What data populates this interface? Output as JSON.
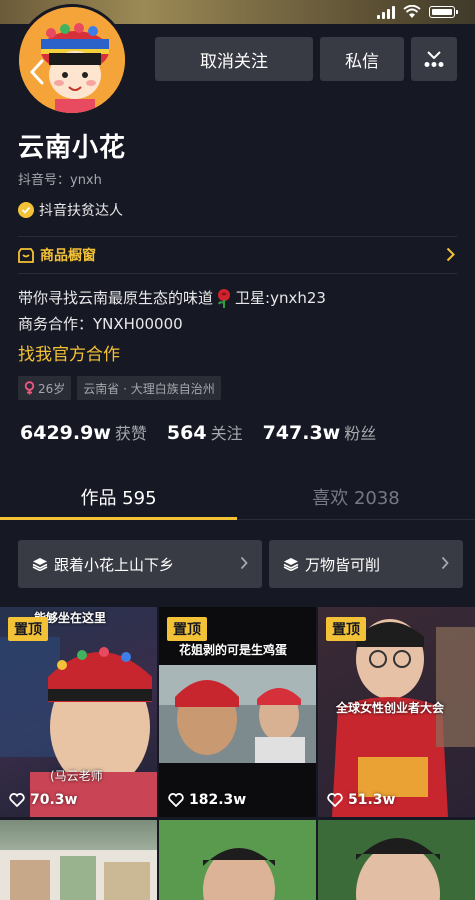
{
  "header": {
    "unfollow_label": "取消关注",
    "message_label": "私信"
  },
  "profile": {
    "name": "云南小花",
    "douyin_id": "抖音号：ynxh",
    "badge": "抖音扶贫达人",
    "shop_window": "商品橱窗",
    "bio_line1_a": "带你寻找云南最原生态的味道",
    "bio_line1_b": "卫星:ynxh23",
    "bio_line2": "商务合作：YNXH00000",
    "official_link": "找我官方合作",
    "tags": [
      {
        "text": "26岁"
      },
      {
        "text": "云南省 · 大理白族自治州"
      }
    ]
  },
  "stats": {
    "likes_value": "6429.9w",
    "likes_label": "获赞",
    "following_value": "564",
    "following_label": "关注",
    "fans_value": "747.3w",
    "fans_label": "粉丝"
  },
  "tabs": {
    "works": "作品 595",
    "likes": "喜欢 2038"
  },
  "collections": [
    {
      "label": "跟着小花上山下乡"
    },
    {
      "label": "万物皆可削"
    }
  ],
  "videos": [
    {
      "pinned": "置顶",
      "caption_top": "能够坐在这里",
      "caption_bottom": "(马云老师",
      "likes": "70.3w"
    },
    {
      "pinned": "置顶",
      "caption_top": "花姐剥的可是生鸡蛋",
      "likes": "182.3w"
    },
    {
      "pinned": "置顶",
      "caption_top": "全球女性创业者大会",
      "likes": "51.3w"
    }
  ],
  "colors": {
    "accent": "#f4c236",
    "background": "#161823",
    "button": "#393b44",
    "muted_text": "#a6a7ad"
  }
}
